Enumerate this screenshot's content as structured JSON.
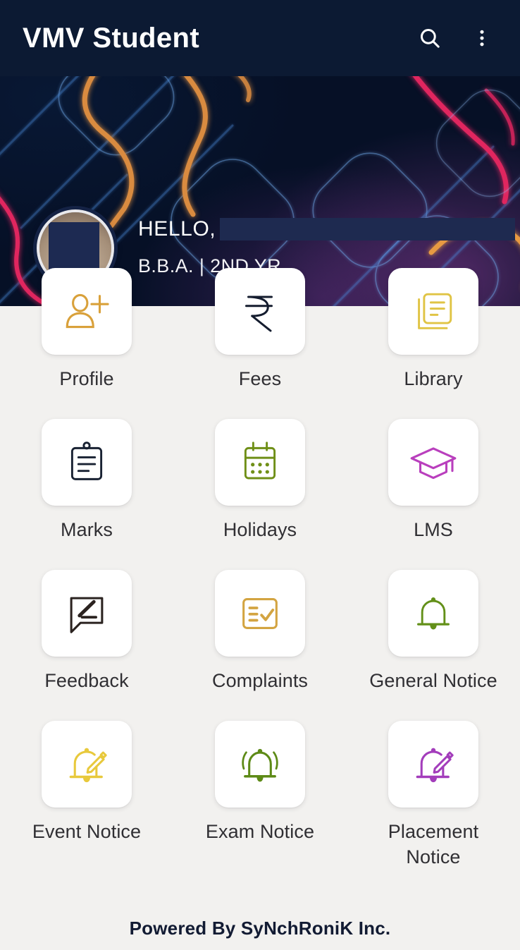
{
  "appbar": {
    "title": "VMV Student",
    "search_icon": "search-icon",
    "overflow_icon": "more-vertical-icon"
  },
  "hero": {
    "greeting": "HELLO,",
    "name_value": "",
    "name_redacted": true,
    "course_year": "B.B.A. | 2ND YR",
    "avatar_redacted": true
  },
  "grid": {
    "tiles": [
      {
        "label": "Profile",
        "icon": "user-add-icon",
        "color": "#d9a13b"
      },
      {
        "label": "Fees",
        "icon": "rupee-icon",
        "color": "#141c2e"
      },
      {
        "label": "Library",
        "icon": "documents-icon",
        "color": "#e0c445"
      },
      {
        "label": "Marks",
        "icon": "clipboard-icon",
        "color": "#182132"
      },
      {
        "label": "Holidays",
        "icon": "calendar-icon",
        "color": "#6f8f17"
      },
      {
        "label": "LMS",
        "icon": "graduation-cap-icon",
        "color": "#b93fbd"
      },
      {
        "label": "Feedback",
        "icon": "feedback-edit-icon",
        "color": "#2b2320"
      },
      {
        "label": "Complaints",
        "icon": "checklist-icon",
        "color": "#d3a441"
      },
      {
        "label": "General Notice",
        "icon": "bell-icon",
        "color": "#639019"
      },
      {
        "label": "Event Notice",
        "icon": "bell-edit-icon",
        "color": "#e8c93c"
      },
      {
        "label": "Exam Notice",
        "icon": "bell-ring-icon",
        "color": "#5d8a16"
      },
      {
        "label": "Placement Notice",
        "icon": "bell-edit-icon",
        "color": "#a33dbb"
      }
    ]
  },
  "footer": {
    "powered_by": "Powered By SyNchRoniK Inc."
  },
  "colors": {
    "appbar_bg": "#0c1a33",
    "page_bg": "#f2f1ef",
    "card_bg": "#ffffff",
    "label_text": "#302f33",
    "footer_text": "#121b33",
    "redaction": "#1e2a50",
    "neon_orange": "#e08a3c",
    "neon_pink": "#e0265f",
    "neon_blue": "#4d8fe0"
  }
}
